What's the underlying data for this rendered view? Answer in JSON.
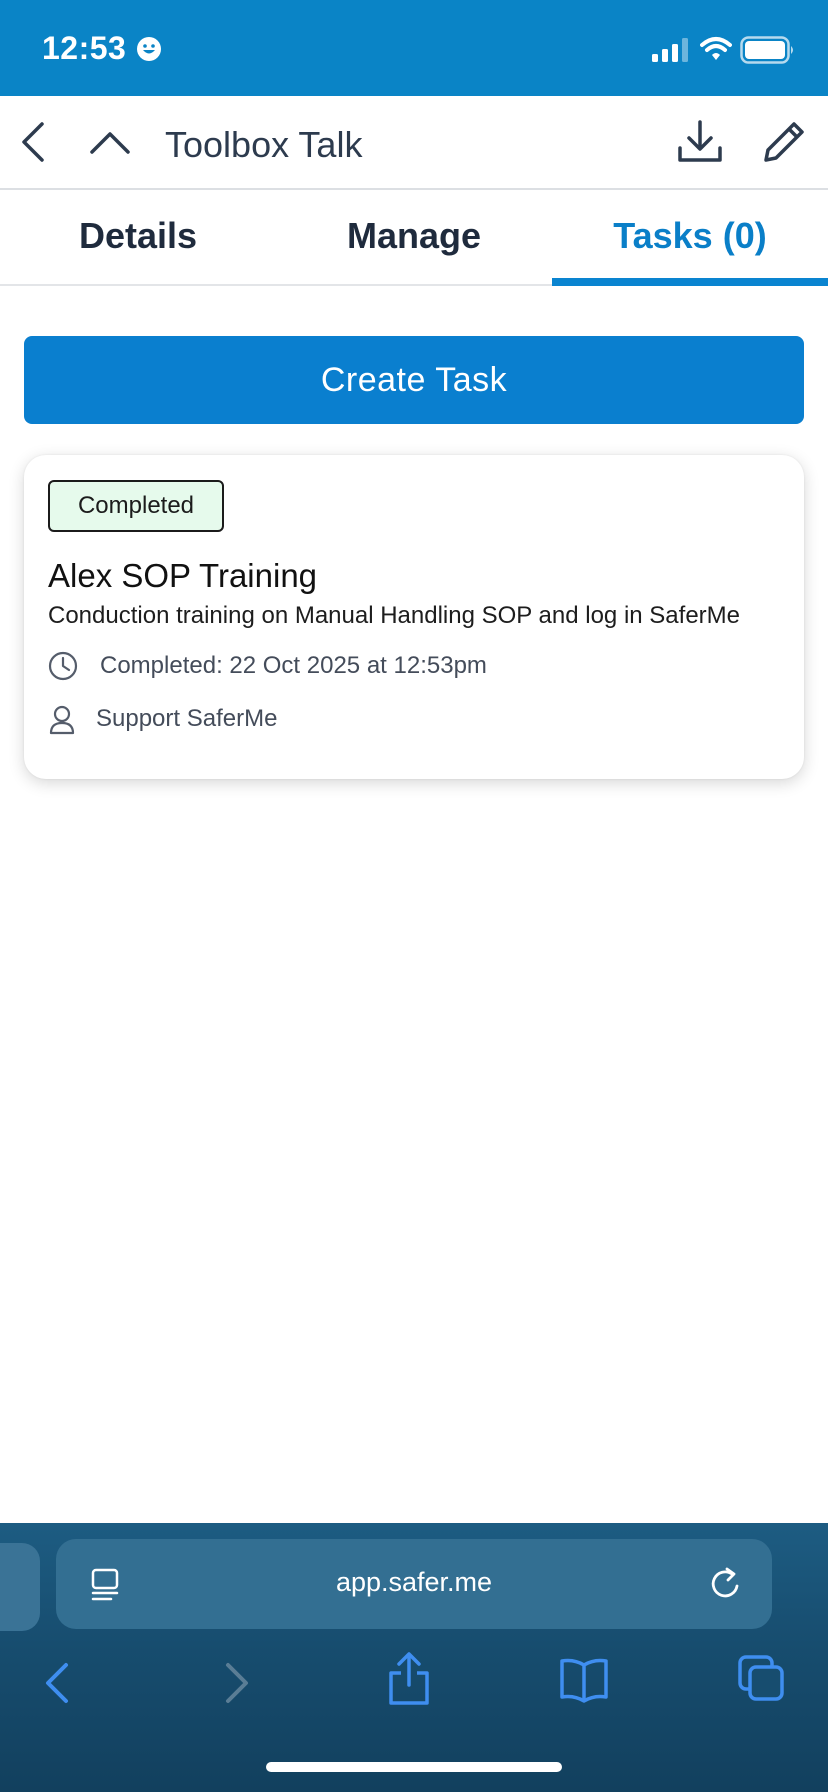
{
  "status_bar": {
    "time": "12:53"
  },
  "header": {
    "title": "Toolbox Talk"
  },
  "tabs": [
    {
      "label": "Details",
      "active": false
    },
    {
      "label": "Manage",
      "active": false
    },
    {
      "label": "Tasks (0)",
      "active": true
    }
  ],
  "actions": {
    "create_task_label": "Create Task"
  },
  "tasks": [
    {
      "status": "Completed",
      "title": "Alex SOP Training",
      "description": "Conduction training on Manual Handling SOP and log in SaferMe",
      "completed_text": "Completed: 22 Oct 2025 at 12:53pm",
      "assignee": "Support SaferMe"
    }
  ],
  "browser": {
    "url": "app.safer.me"
  },
  "colors": {
    "brand_blue": "#0a84c6",
    "button_blue": "#0a7fcf",
    "badge_green_bg": "#e6faec",
    "browser_bar": "#174d6f"
  },
  "icons": {
    "header": [
      "back-chevron-icon",
      "collapse-chevron-icon",
      "download-icon",
      "edit-pencil-icon"
    ],
    "card": [
      "clock-icon",
      "user-icon"
    ],
    "browser": [
      "page-icon",
      "reload-icon",
      "back-arrow-icon",
      "forward-arrow-icon",
      "share-icon",
      "bookmarks-icon",
      "tabs-icon"
    ]
  }
}
